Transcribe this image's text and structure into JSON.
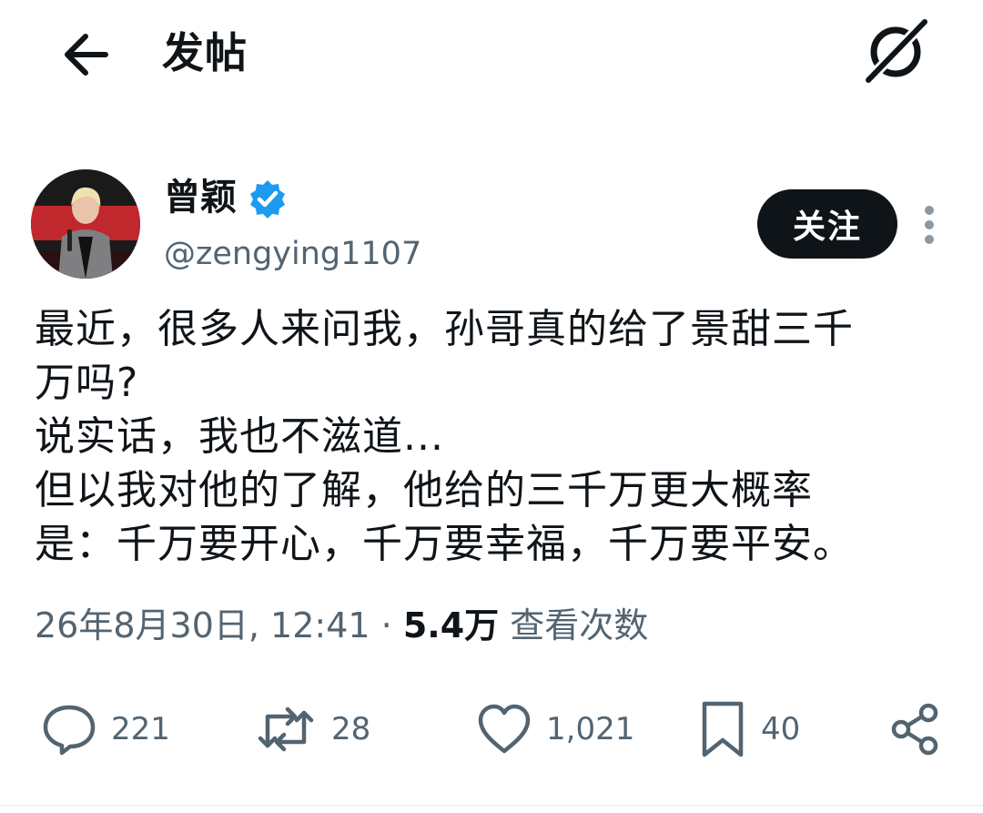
{
  "header": {
    "title": "发帖",
    "back_icon": "arrow-left-icon",
    "grok_icon": "grok-icon"
  },
  "author": {
    "display_name": "曾颖",
    "handle": "@zengying1107",
    "verified": true,
    "verified_color": "#1d9bf0",
    "follow_label": "关注"
  },
  "post": {
    "lines": [
      "最近，很多人来问我，孙哥真的给了景甜三千",
      "万吗?",
      "说实话，我也不滋道...",
      "但以我对他的了解，他给的三千万更大概率",
      "是：千万要开心，千万要幸福，千万要平安。"
    ]
  },
  "meta": {
    "datetime": "26年8月30日, 12:41",
    "separator": " · ",
    "views_count": "5.4万",
    "views_label": " 查看次数"
  },
  "actions": {
    "replies": "221",
    "reposts": "28",
    "likes": "1,021",
    "bookmarks": "40"
  },
  "colors": {
    "text_primary": "#0f1419",
    "text_secondary": "#536471",
    "follow_bg": "#0f1419"
  }
}
